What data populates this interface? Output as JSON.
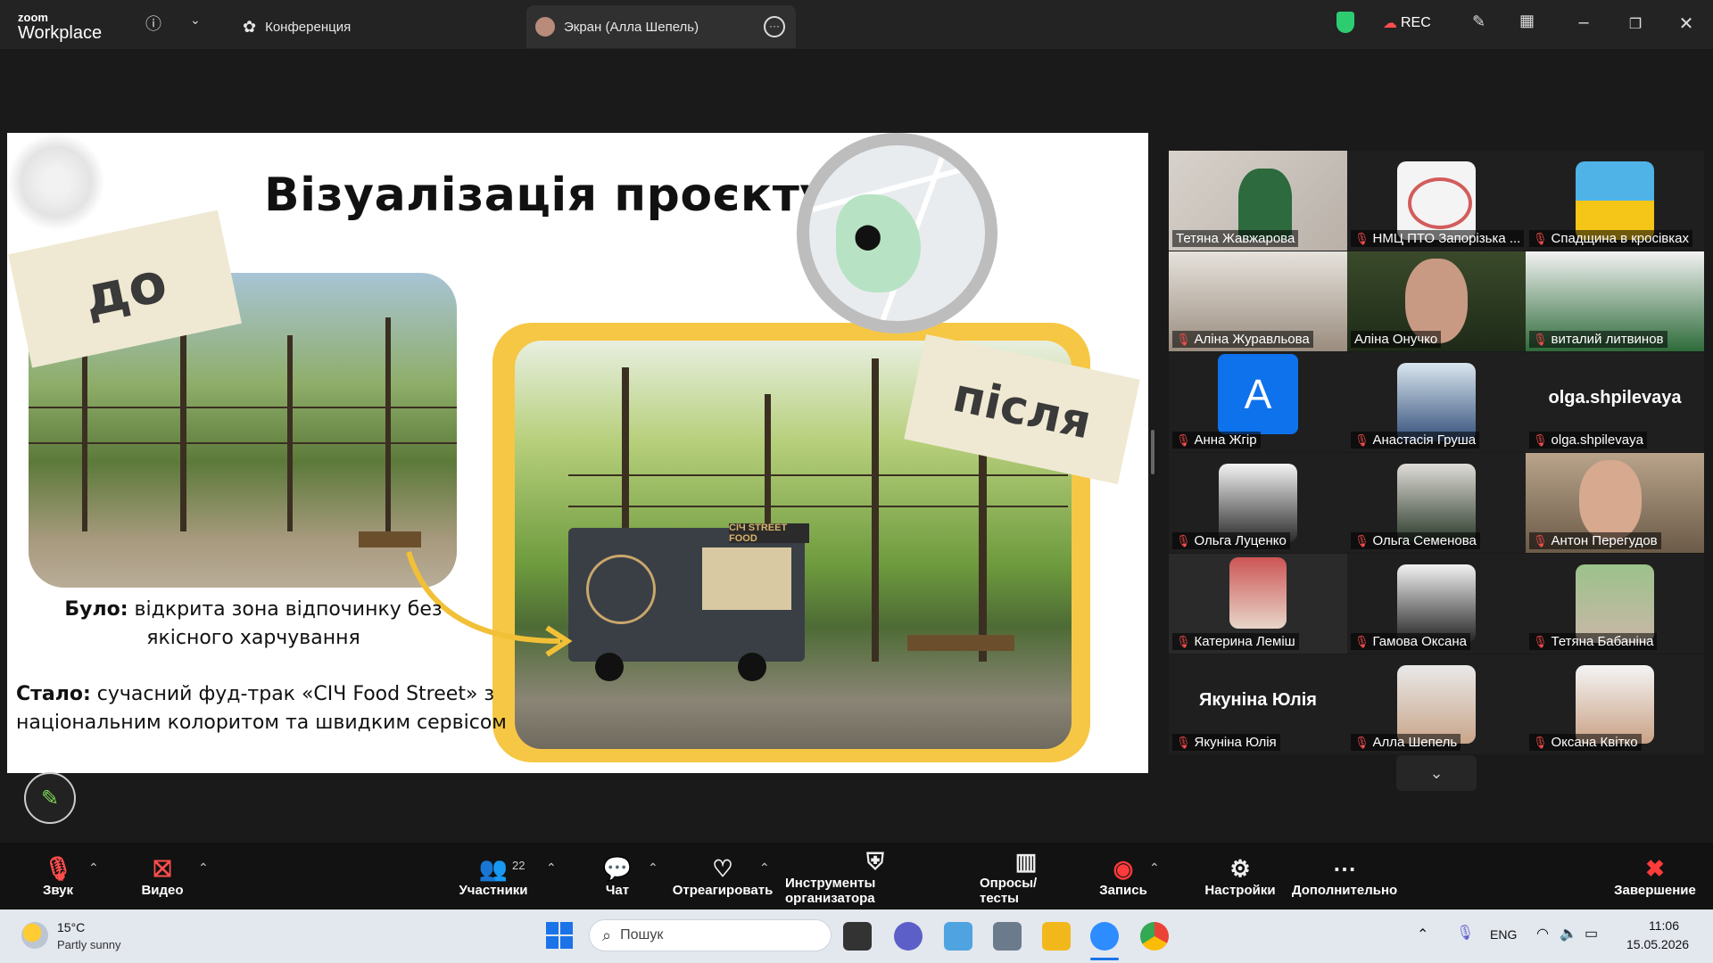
{
  "app": {
    "logo_small": "zoom",
    "logo_big": "Workplace"
  },
  "tabs": [
    {
      "label": "Конференция"
    },
    {
      "label": "Экран (Алла Шепель)"
    }
  ],
  "topbar": {
    "rec_label": "REC"
  },
  "slide": {
    "title": "Візуалізація проєкту",
    "tag_before": "до",
    "tag_after": "після",
    "was_label": "Було:",
    "was_text": " відкрита зона відпочинку без якісного харчування",
    "now_label": "Стало:",
    "now_text": " сучасний фуд-трак «СІЧ Food Street» з національним колоритом та швидким сервісом",
    "truck_sign": "СІЧ STREET FOOD"
  },
  "participants": [
    {
      "name": "Тетяна Жавжарова",
      "muted": false
    },
    {
      "name": "НМЦ ПТО Запорізька ...",
      "muted": true
    },
    {
      "name": "Спадщина в кросівках",
      "muted": true
    },
    {
      "name": "Аліна Журавльова",
      "muted": true
    },
    {
      "name": "Аліна Онучко",
      "muted": false
    },
    {
      "name": "виталий литвинов",
      "muted": true
    },
    {
      "name": "Анна Жгір",
      "muted": true,
      "letter": "A"
    },
    {
      "name": "Анастасія Груша",
      "muted": true
    },
    {
      "name": "olga.shpilevaya",
      "muted": true,
      "big_name": "olga.shpilevaya"
    },
    {
      "name": "Ольга Луценко",
      "muted": true
    },
    {
      "name": "Ольга Семенова",
      "muted": true
    },
    {
      "name": "Антон Перегудов",
      "muted": true
    },
    {
      "name": "Катерина Леміш",
      "muted": true
    },
    {
      "name": "Гамова Оксана",
      "muted": true
    },
    {
      "name": "Тетяна Бабаніна",
      "muted": true
    },
    {
      "name": "Якуніна Юлія",
      "muted": true,
      "big_name": "Якуніна Юлія"
    },
    {
      "name": "Алла Шепель",
      "muted": true
    },
    {
      "name": "Оксана Квітко",
      "muted": true
    }
  ],
  "toolbar": {
    "audio": "Звук",
    "video": "Видео",
    "participants": "Участники",
    "participants_count": "22",
    "chat": "Чат",
    "react": "Отреагировать",
    "host_tools": "Инструменты организатора",
    "polls": "Опросы/тесты",
    "record": "Запись",
    "settings": "Настройки",
    "more": "Дополнительно",
    "end": "Завершение"
  },
  "taskbar": {
    "weather_temp": "15°C",
    "weather_desc": "Partly sunny",
    "search_placeholder": "Пошук",
    "lang": "ENG",
    "time": "11:06",
    "date": "15.05.2026"
  },
  "colors": {
    "accent_green": "#2ecc71",
    "slide_yellow": "#f6c744",
    "tag_beige": "#efe9d3",
    "mute_red": "#ff4d4d"
  }
}
